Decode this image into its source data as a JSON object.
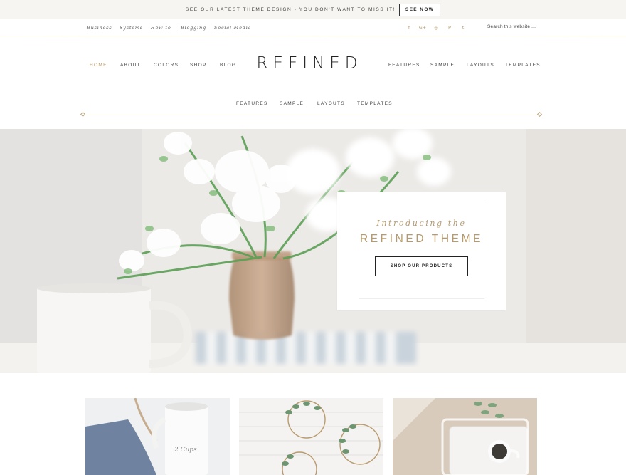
{
  "announcement": {
    "text": "SEE OUR LATEST THEME DESIGN - YOU DON'T WANT TO MISS IT!",
    "button_label": "SEE NOW"
  },
  "secondary_nav": {
    "links": [
      "Business",
      "Systems",
      "How to",
      "Blogging",
      "Social Media"
    ],
    "social_icons": [
      "facebook-icon",
      "google-plus-icon",
      "instagram-icon",
      "pinterest-icon",
      "twitter-icon"
    ],
    "social_glyphs": [
      "f",
      "G+",
      "◎",
      "P",
      "t"
    ],
    "search_placeholder": "Search this website ..."
  },
  "header": {
    "logo": "REFINED",
    "nav_left": [
      "HOME",
      "ABOUT",
      "COLORS",
      "SHOP",
      "BLOG"
    ],
    "nav_right": [
      "FEATURES",
      "SAMPLE",
      "LAYOUTS",
      "TEMPLATES"
    ],
    "nav_center": [
      "FEATURES",
      "SAMPLE",
      "LAYOUTS",
      "TEMPLATES"
    ]
  },
  "hero": {
    "intro": "Introducing the",
    "title": "REFINED THEME",
    "button_label": "SHOP OUR PRODUCTS"
  },
  "colors": {
    "accent": "#b69a6b",
    "announcement_bg": "#f7f5f2",
    "text": "#333333"
  }
}
